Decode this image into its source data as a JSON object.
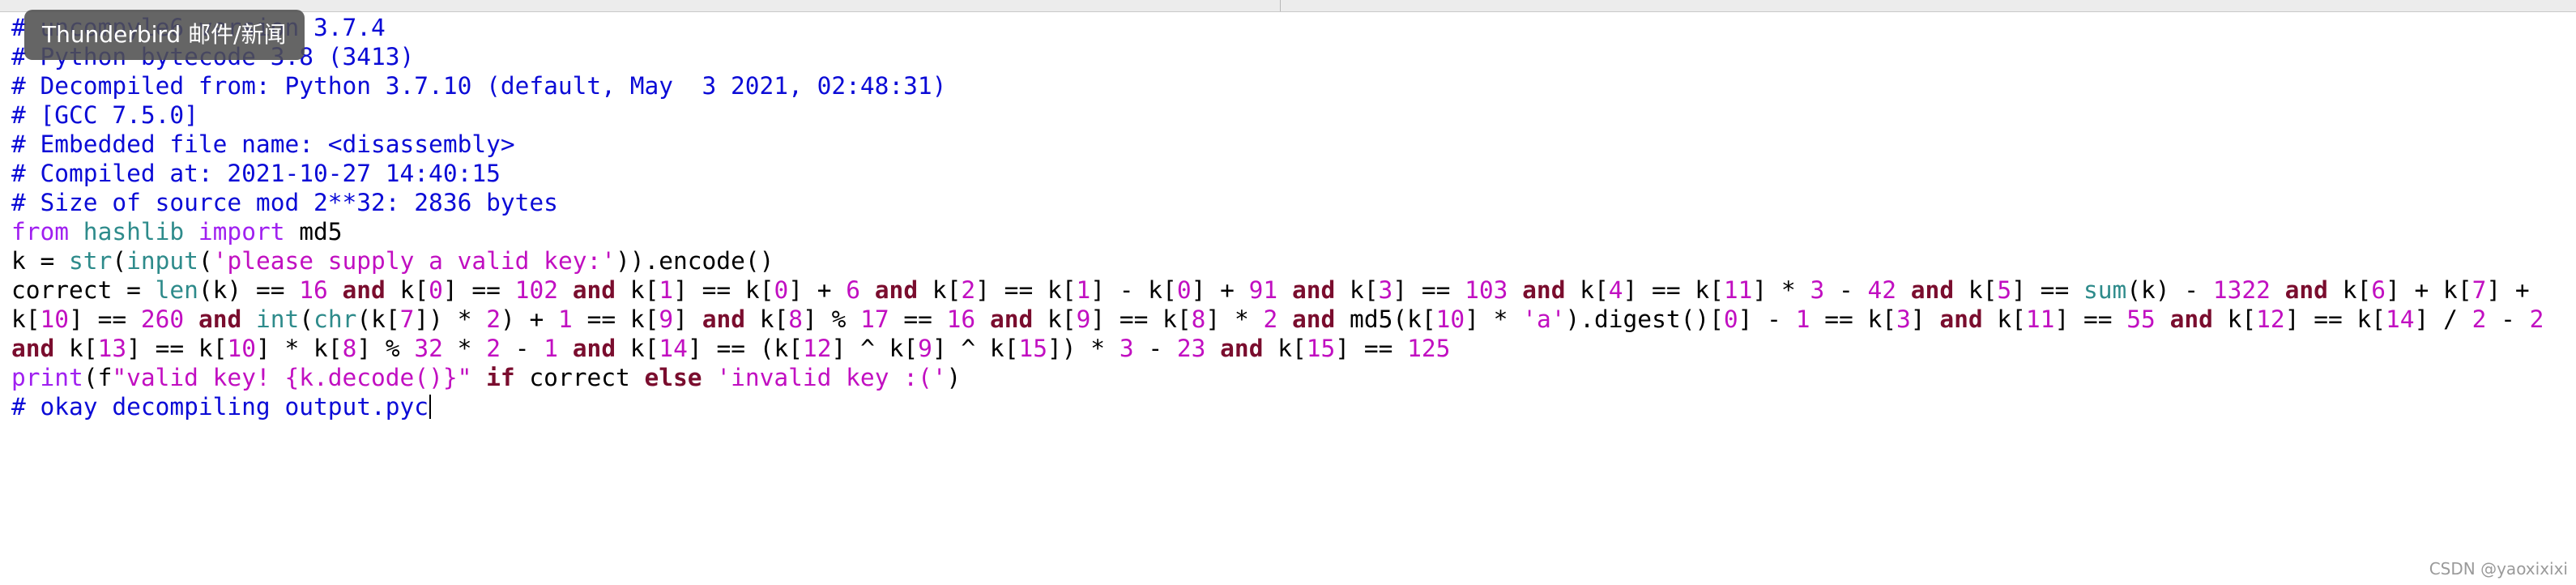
{
  "tooltip": {
    "text": "Thunderbird 邮件/新闻"
  },
  "watermark": {
    "text": "CSDN @yaoxixixi"
  },
  "code_lines": [
    [
      {
        "t": "# uncompyle6 version 3.7.4",
        "c": "c"
      }
    ],
    [
      {
        "t": "# Python bytecode 3.8 (3413)",
        "c": "c"
      }
    ],
    [
      {
        "t": "# Decompiled from: Python 3.7.10 (default, May  3 2021, 02:48:31)",
        "c": "c"
      }
    ],
    [
      {
        "t": "# [GCC 7.5.0]",
        "c": "c"
      }
    ],
    [
      {
        "t": "# Embedded file name: <disassembly>",
        "c": "c"
      }
    ],
    [
      {
        "t": "# Compiled at: 2021-10-27 14:40:15",
        "c": "c"
      }
    ],
    [
      {
        "t": "# Size of source mod 2**32: 2836 bytes",
        "c": "c"
      }
    ],
    [
      {
        "t": "from",
        "c": "kp"
      },
      {
        "t": " hashlib ",
        "c": "b"
      },
      {
        "t": "import",
        "c": "kp"
      },
      {
        "t": " md5",
        "c": ""
      }
    ],
    [
      {
        "t": "k = ",
        "c": ""
      },
      {
        "t": "str",
        "c": "b"
      },
      {
        "t": "(",
        "c": ""
      },
      {
        "t": "input",
        "c": "b"
      },
      {
        "t": "(",
        "c": ""
      },
      {
        "t": "'please supply a valid key:'",
        "c": "n"
      },
      {
        "t": ")).encode()",
        "c": ""
      }
    ],
    [
      {
        "t": "correct = ",
        "c": ""
      },
      {
        "t": "len",
        "c": "b"
      },
      {
        "t": "(k) == ",
        "c": ""
      },
      {
        "t": "16",
        "c": "n"
      },
      {
        "t": " ",
        "c": ""
      },
      {
        "t": "and",
        "c": "k"
      },
      {
        "t": " k[",
        "c": ""
      },
      {
        "t": "0",
        "c": "n"
      },
      {
        "t": "] == ",
        "c": ""
      },
      {
        "t": "102",
        "c": "n"
      },
      {
        "t": " ",
        "c": ""
      },
      {
        "t": "and",
        "c": "k"
      },
      {
        "t": " k[",
        "c": ""
      },
      {
        "t": "1",
        "c": "n"
      },
      {
        "t": "] == k[",
        "c": ""
      },
      {
        "t": "0",
        "c": "n"
      },
      {
        "t": "] + ",
        "c": ""
      },
      {
        "t": "6",
        "c": "n"
      },
      {
        "t": " ",
        "c": ""
      },
      {
        "t": "and",
        "c": "k"
      },
      {
        "t": " k[",
        "c": ""
      },
      {
        "t": "2",
        "c": "n"
      },
      {
        "t": "] == k[",
        "c": ""
      },
      {
        "t": "1",
        "c": "n"
      },
      {
        "t": "] - k[",
        "c": ""
      },
      {
        "t": "0",
        "c": "n"
      },
      {
        "t": "] + ",
        "c": ""
      },
      {
        "t": "91",
        "c": "n"
      },
      {
        "t": " ",
        "c": ""
      },
      {
        "t": "and",
        "c": "k"
      },
      {
        "t": " k[",
        "c": ""
      },
      {
        "t": "3",
        "c": "n"
      },
      {
        "t": "] == ",
        "c": ""
      },
      {
        "t": "103",
        "c": "n"
      },
      {
        "t": " ",
        "c": ""
      },
      {
        "t": "and",
        "c": "k"
      },
      {
        "t": " k[",
        "c": ""
      },
      {
        "t": "4",
        "c": "n"
      },
      {
        "t": "] == k[",
        "c": ""
      },
      {
        "t": "11",
        "c": "n"
      },
      {
        "t": "] * ",
        "c": ""
      },
      {
        "t": "3",
        "c": "n"
      },
      {
        "t": " - ",
        "c": ""
      },
      {
        "t": "42",
        "c": "n"
      },
      {
        "t": " ",
        "c": ""
      },
      {
        "t": "and",
        "c": "k"
      },
      {
        "t": " k[",
        "c": ""
      },
      {
        "t": "5",
        "c": "n"
      },
      {
        "t": "] == ",
        "c": ""
      },
      {
        "t": "sum",
        "c": "b"
      },
      {
        "t": "(k) - ",
        "c": ""
      },
      {
        "t": "1322",
        "c": "n"
      },
      {
        "t": " ",
        "c": ""
      },
      {
        "t": "and",
        "c": "k"
      },
      {
        "t": " k[",
        "c": ""
      },
      {
        "t": "6",
        "c": "n"
      },
      {
        "t": "] + k[",
        "c": ""
      },
      {
        "t": "7",
        "c": "n"
      },
      {
        "t": "] + ",
        "c": ""
      }
    ],
    [
      {
        "t": "k[",
        "c": ""
      },
      {
        "t": "10",
        "c": "n"
      },
      {
        "t": "] == ",
        "c": ""
      },
      {
        "t": "260",
        "c": "n"
      },
      {
        "t": " ",
        "c": ""
      },
      {
        "t": "and",
        "c": "k"
      },
      {
        "t": " ",
        "c": ""
      },
      {
        "t": "int",
        "c": "b"
      },
      {
        "t": "(",
        "c": ""
      },
      {
        "t": "chr",
        "c": "b"
      },
      {
        "t": "(k[",
        "c": ""
      },
      {
        "t": "7",
        "c": "n"
      },
      {
        "t": "]) * ",
        "c": ""
      },
      {
        "t": "2",
        "c": "n"
      },
      {
        "t": ") + ",
        "c": ""
      },
      {
        "t": "1",
        "c": "n"
      },
      {
        "t": " == k[",
        "c": ""
      },
      {
        "t": "9",
        "c": "n"
      },
      {
        "t": "] ",
        "c": ""
      },
      {
        "t": "and",
        "c": "k"
      },
      {
        "t": " k[",
        "c": ""
      },
      {
        "t": "8",
        "c": "n"
      },
      {
        "t": "] % ",
        "c": ""
      },
      {
        "t": "17",
        "c": "n"
      },
      {
        "t": " == ",
        "c": ""
      },
      {
        "t": "16",
        "c": "n"
      },
      {
        "t": " ",
        "c": ""
      },
      {
        "t": "and",
        "c": "k"
      },
      {
        "t": " k[",
        "c": ""
      },
      {
        "t": "9",
        "c": "n"
      },
      {
        "t": "] == k[",
        "c": ""
      },
      {
        "t": "8",
        "c": "n"
      },
      {
        "t": "] * ",
        "c": ""
      },
      {
        "t": "2",
        "c": "n"
      },
      {
        "t": " ",
        "c": ""
      },
      {
        "t": "and",
        "c": "k"
      },
      {
        "t": " md5(k[",
        "c": ""
      },
      {
        "t": "10",
        "c": "n"
      },
      {
        "t": "] * ",
        "c": ""
      },
      {
        "t": "'a'",
        "c": "n"
      },
      {
        "t": ").digest()[",
        "c": ""
      },
      {
        "t": "0",
        "c": "n"
      },
      {
        "t": "] - ",
        "c": ""
      },
      {
        "t": "1",
        "c": "n"
      },
      {
        "t": " == k[",
        "c": ""
      },
      {
        "t": "3",
        "c": "n"
      },
      {
        "t": "] ",
        "c": ""
      },
      {
        "t": "and",
        "c": "k"
      },
      {
        "t": " k[",
        "c": ""
      },
      {
        "t": "11",
        "c": "n"
      },
      {
        "t": "] == ",
        "c": ""
      },
      {
        "t": "55",
        "c": "n"
      },
      {
        "t": " ",
        "c": ""
      },
      {
        "t": "and",
        "c": "k"
      },
      {
        "t": " k[",
        "c": ""
      },
      {
        "t": "12",
        "c": "n"
      },
      {
        "t": "] == k[",
        "c": ""
      },
      {
        "t": "14",
        "c": "n"
      },
      {
        "t": "] / ",
        "c": ""
      },
      {
        "t": "2",
        "c": "n"
      },
      {
        "t": " - ",
        "c": ""
      },
      {
        "t": "2",
        "c": "n"
      }
    ],
    [
      {
        "t": "and",
        "c": "k"
      },
      {
        "t": " k[",
        "c": ""
      },
      {
        "t": "13",
        "c": "n"
      },
      {
        "t": "] == k[",
        "c": ""
      },
      {
        "t": "10",
        "c": "n"
      },
      {
        "t": "] * k[",
        "c": ""
      },
      {
        "t": "8",
        "c": "n"
      },
      {
        "t": "] % ",
        "c": ""
      },
      {
        "t": "32",
        "c": "n"
      },
      {
        "t": " * ",
        "c": ""
      },
      {
        "t": "2",
        "c": "n"
      },
      {
        "t": " - ",
        "c": ""
      },
      {
        "t": "1",
        "c": "n"
      },
      {
        "t": " ",
        "c": ""
      },
      {
        "t": "and",
        "c": "k"
      },
      {
        "t": " k[",
        "c": ""
      },
      {
        "t": "14",
        "c": "n"
      },
      {
        "t": "] == (k[",
        "c": ""
      },
      {
        "t": "12",
        "c": "n"
      },
      {
        "t": "] ^ k[",
        "c": ""
      },
      {
        "t": "9",
        "c": "n"
      },
      {
        "t": "] ^ k[",
        "c": ""
      },
      {
        "t": "15",
        "c": "n"
      },
      {
        "t": "]) * ",
        "c": ""
      },
      {
        "t": "3",
        "c": "n"
      },
      {
        "t": " - ",
        "c": ""
      },
      {
        "t": "23",
        "c": "n"
      },
      {
        "t": " ",
        "c": ""
      },
      {
        "t": "and",
        "c": "k"
      },
      {
        "t": " k[",
        "c": ""
      },
      {
        "t": "15",
        "c": "n"
      },
      {
        "t": "] == ",
        "c": ""
      },
      {
        "t": "125",
        "c": "n"
      }
    ],
    [
      {
        "t": "print",
        "c": "kp"
      },
      {
        "t": "(f",
        "c": ""
      },
      {
        "t": "\"valid key! {k.decode()}\"",
        "c": "n"
      },
      {
        "t": " ",
        "c": ""
      },
      {
        "t": "if",
        "c": "k"
      },
      {
        "t": " correct ",
        "c": ""
      },
      {
        "t": "else",
        "c": "k"
      },
      {
        "t": " ",
        "c": ""
      },
      {
        "t": "'invalid key :('",
        "c": "n"
      },
      {
        "t": ")",
        "c": ""
      }
    ],
    [
      {
        "t": "# okay decompiling output.pyc",
        "c": "c"
      }
    ]
  ]
}
